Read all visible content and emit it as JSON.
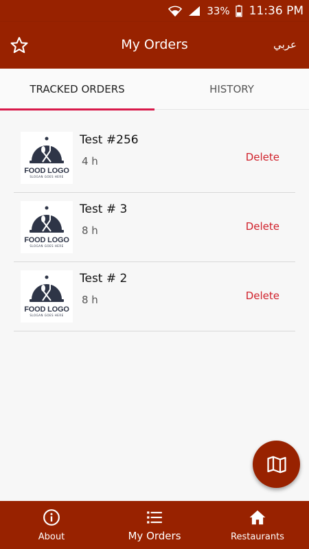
{
  "status_bar": {
    "battery": "33%",
    "time": "11:36 PM"
  },
  "app_bar": {
    "title": "My Orders",
    "language_toggle": "عربي",
    "favorite_icon": "star-icon"
  },
  "tabs": [
    {
      "label": "TRACKED ORDERS",
      "active": true
    },
    {
      "label": "HISTORY",
      "active": false
    }
  ],
  "logo": {
    "text": "FOOD LOGO",
    "slogan": "SLOGAN GOES HERE"
  },
  "orders": [
    {
      "name": "Test  #256",
      "ago": "4 h",
      "action": "Delete"
    },
    {
      "name": "Test  # 3",
      "ago": "8 h",
      "action": "Delete"
    },
    {
      "name": "Test  # 2",
      "ago": "8 h",
      "action": "Delete"
    }
  ],
  "fab": {
    "icon": "map-icon"
  },
  "bottom_nav": [
    {
      "label": "About",
      "icon": "info-icon"
    },
    {
      "label": "My Orders",
      "icon": "list-icon",
      "active": true
    },
    {
      "label": "Restaurants",
      "icon": "home-icon"
    }
  ],
  "colors": {
    "primary": "#982200",
    "tab_indicator": "#d8194a",
    "delete": "#d0202a"
  }
}
